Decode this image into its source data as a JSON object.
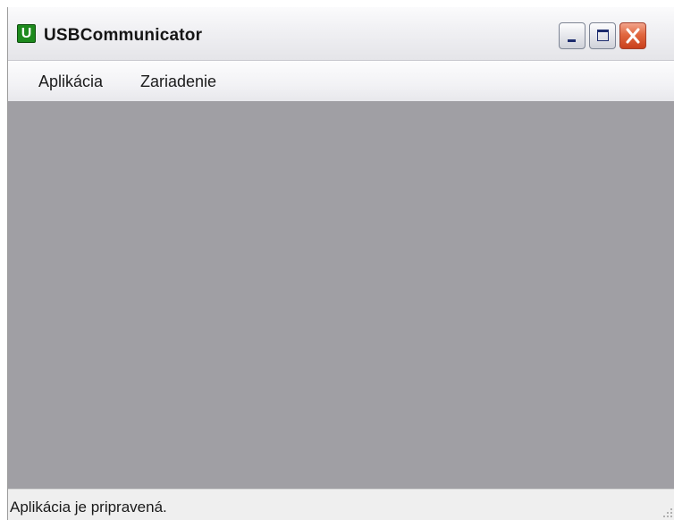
{
  "window": {
    "title": "USBCommunicator",
    "icon_letter": "U",
    "icon": "app-icon",
    "controls": {
      "minimize_icon": "minimize-icon",
      "maximize_icon": "maximize-icon",
      "close_icon": "close-icon"
    }
  },
  "menu": {
    "items": [
      {
        "label": "Aplikácia"
      },
      {
        "label": "Zariadenie"
      }
    ]
  },
  "status": {
    "text": "Aplikácia je pripravená."
  },
  "colors": {
    "client_background": "#a09fa4",
    "close_button": "#e1673f",
    "app_icon": "#1d8a1d"
  }
}
